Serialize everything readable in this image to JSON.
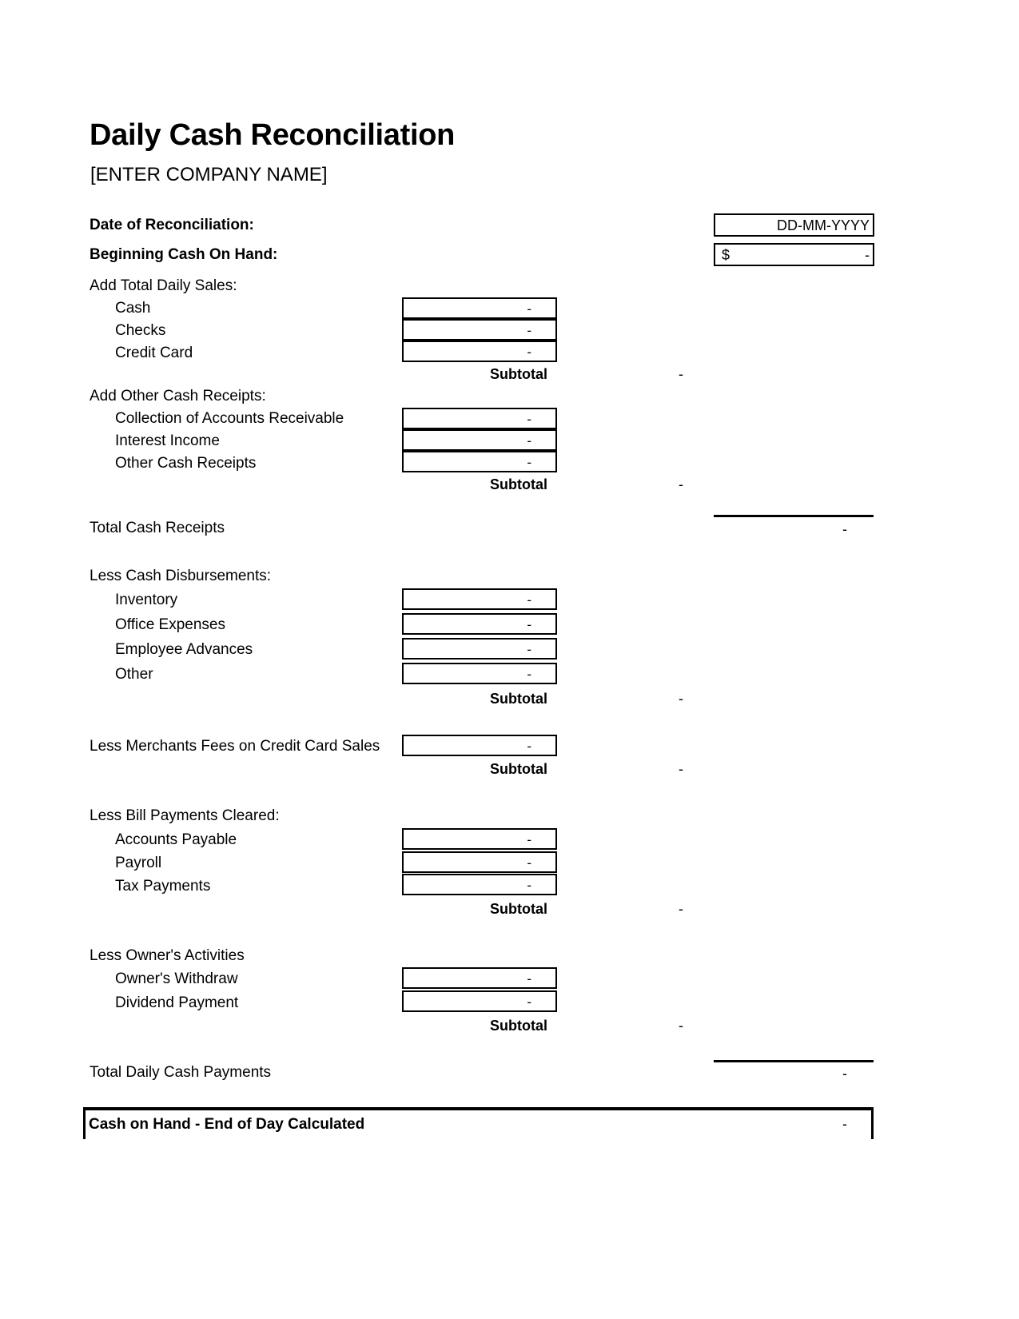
{
  "document": {
    "title": "Daily Cash Reconciliation",
    "company_placeholder": "[ENTER COMPANY NAME]"
  },
  "header_fields": {
    "date_label": "Date of Reconciliation:",
    "date_value": "DD-MM-YYYY",
    "beginning_label": "Beginning Cash On Hand:",
    "beginning_currency": "$",
    "beginning_value": "-"
  },
  "captions": {
    "subtotal": "Subtotal"
  },
  "sections": {
    "daily_sales": {
      "heading": "Add Total Daily Sales:",
      "items": [
        {
          "label": "Cash",
          "value": "-"
        },
        {
          "label": "Checks",
          "value": "-"
        },
        {
          "label": "Credit Card",
          "value": "-"
        }
      ],
      "subtotal_value": "-"
    },
    "other_receipts": {
      "heading": "Add Other Cash Receipts:",
      "items": [
        {
          "label": "Collection of Accounts Receivable",
          "value": "-"
        },
        {
          "label": "Interest Income",
          "value": "-"
        },
        {
          "label": "Other Cash Receipts",
          "value": "-"
        }
      ],
      "subtotal_value": "-"
    },
    "total_cash_receipts": {
      "label": "Total Cash Receipts",
      "value": "-"
    },
    "disbursements": {
      "heading": "Less Cash Disbursements:",
      "items": [
        {
          "label": "Inventory",
          "value": "-"
        },
        {
          "label": "Office Expenses",
          "value": "-"
        },
        {
          "label": "Employee Advances",
          "value": "-"
        },
        {
          "label": "Other",
          "value": "-"
        }
      ],
      "subtotal_value": "-"
    },
    "merchant_fees": {
      "label": "Less Merchants Fees on Credit Card Sales",
      "value": "-",
      "subtotal_value": "-"
    },
    "bill_payments": {
      "heading": "Less Bill Payments Cleared:",
      "items": [
        {
          "label": "Accounts Payable",
          "value": "-"
        },
        {
          "label": "Payroll",
          "value": "-"
        },
        {
          "label": "Tax Payments",
          "value": "-"
        }
      ],
      "subtotal_value": "-"
    },
    "owner_activities": {
      "heading": "Less Owner's Activities",
      "items": [
        {
          "label": "Owner's Withdraw",
          "value": "-"
        },
        {
          "label": "Dividend Payment",
          "value": "-"
        }
      ],
      "subtotal_value": "-"
    },
    "total_daily_payments": {
      "label": "Total Daily Cash Payments",
      "value": "-"
    },
    "end_of_day": {
      "label": "Cash on Hand - End of Day Calculated",
      "value": "-"
    }
  }
}
